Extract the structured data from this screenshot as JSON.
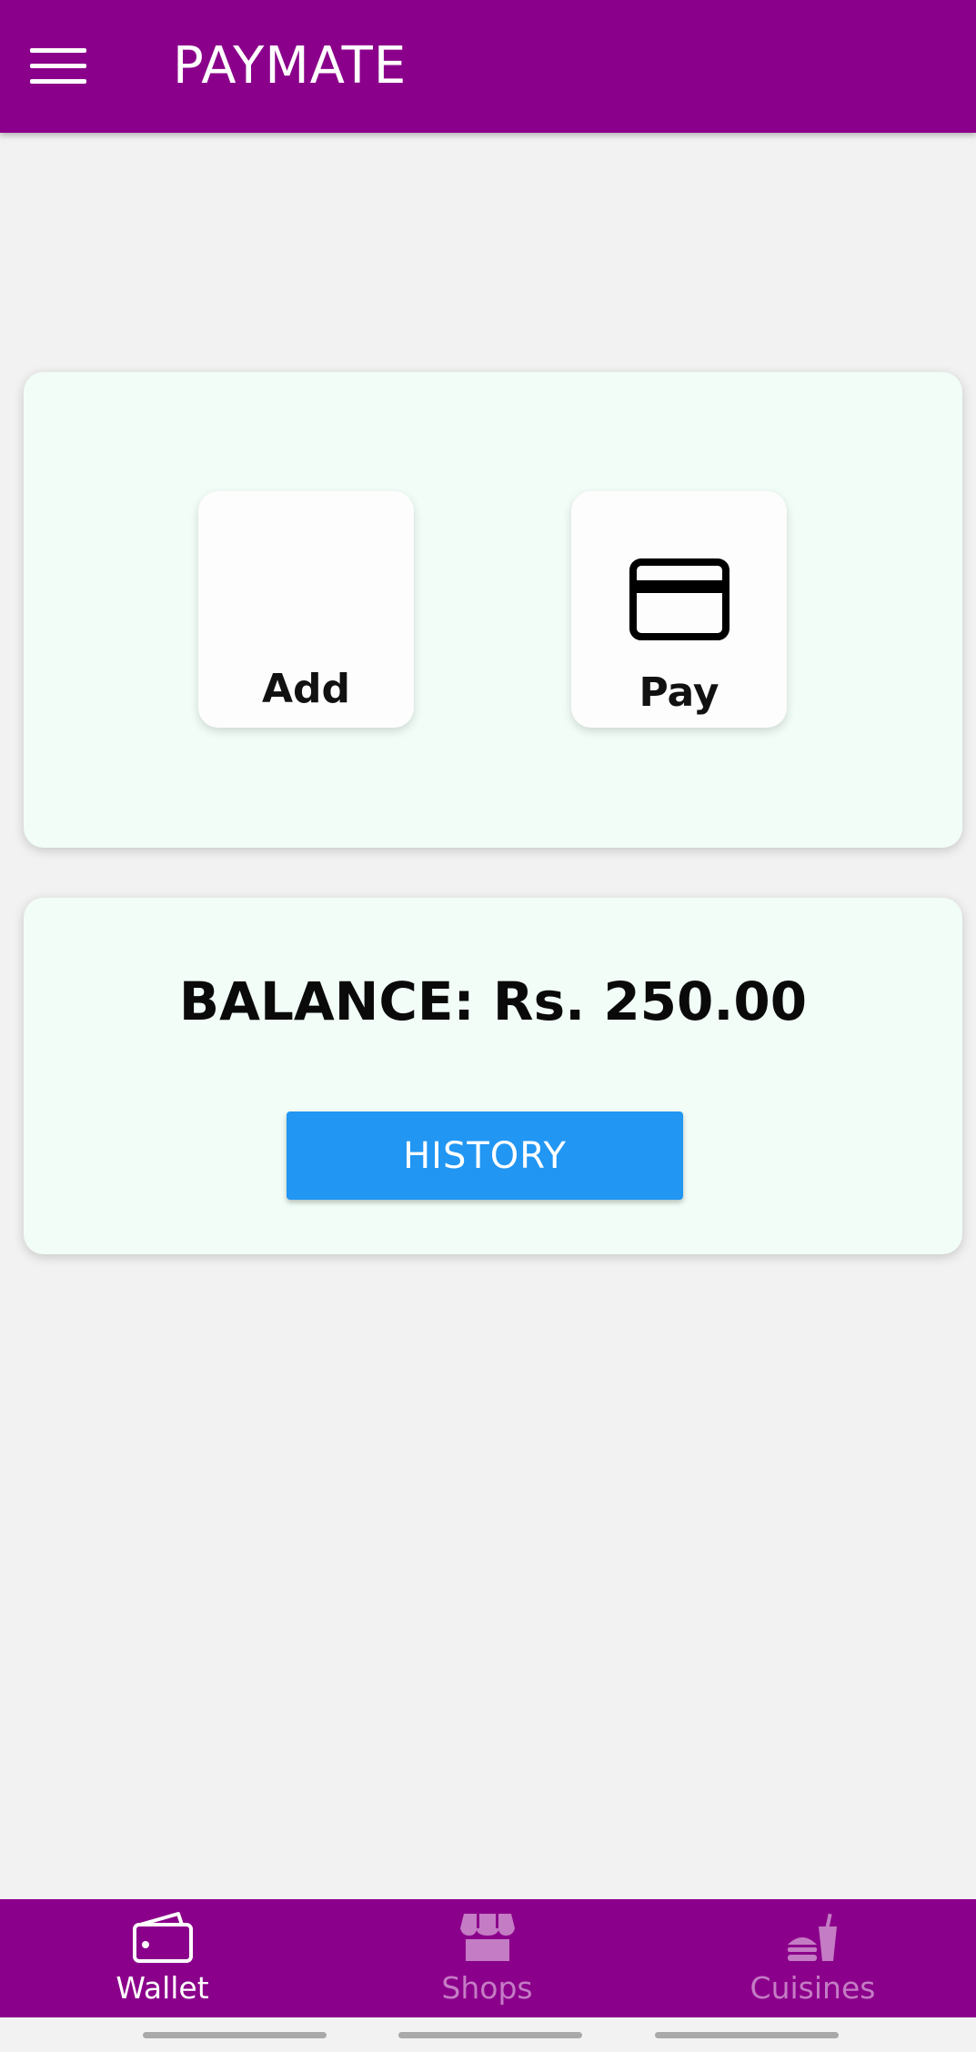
{
  "app_bar": {
    "title": "PAYMATE",
    "background": "#8b008b",
    "menu_icon": "hamburger-menu-icon"
  },
  "actions": {
    "add_label": "Add",
    "pay_label": "Pay",
    "pay_icon": "credit-card-icon"
  },
  "balance": {
    "text": "BALANCE: Rs. 250.00",
    "history_label": "HISTORY",
    "history_color": "#2196f3"
  },
  "bottom_nav": {
    "background": "#8b008b",
    "items": [
      {
        "label": "Wallet",
        "icon": "wallet-icon",
        "active": true
      },
      {
        "label": "Shops",
        "icon": "storefront-icon",
        "active": false
      },
      {
        "label": "Cuisines",
        "icon": "fastfood-icon",
        "active": false
      }
    ]
  }
}
